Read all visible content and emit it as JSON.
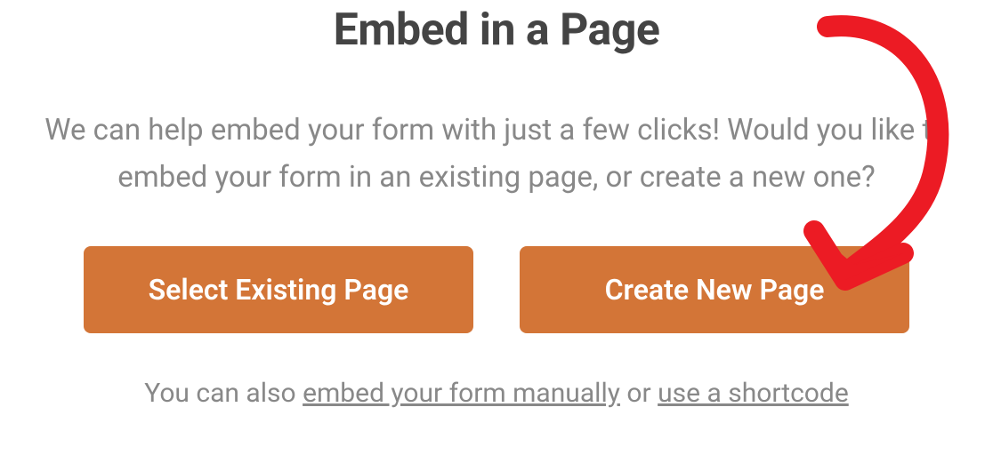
{
  "modal": {
    "title": "Embed in a Page",
    "description": "We can help embed your form with just a few clicks! Would you like to embed your form in an existing page, or create a new one?",
    "buttons": {
      "select_existing": "Select Existing Page",
      "create_new": "Create New Page"
    },
    "footer": {
      "prefix": "You can also ",
      "link_manual": "embed your form manually",
      "middle": " or ",
      "link_shortcode": "use a shortcode"
    }
  },
  "colors": {
    "button_bg": "#d37537",
    "title": "#444444",
    "text_muted": "#888888",
    "annotation": "#ec1b24"
  }
}
